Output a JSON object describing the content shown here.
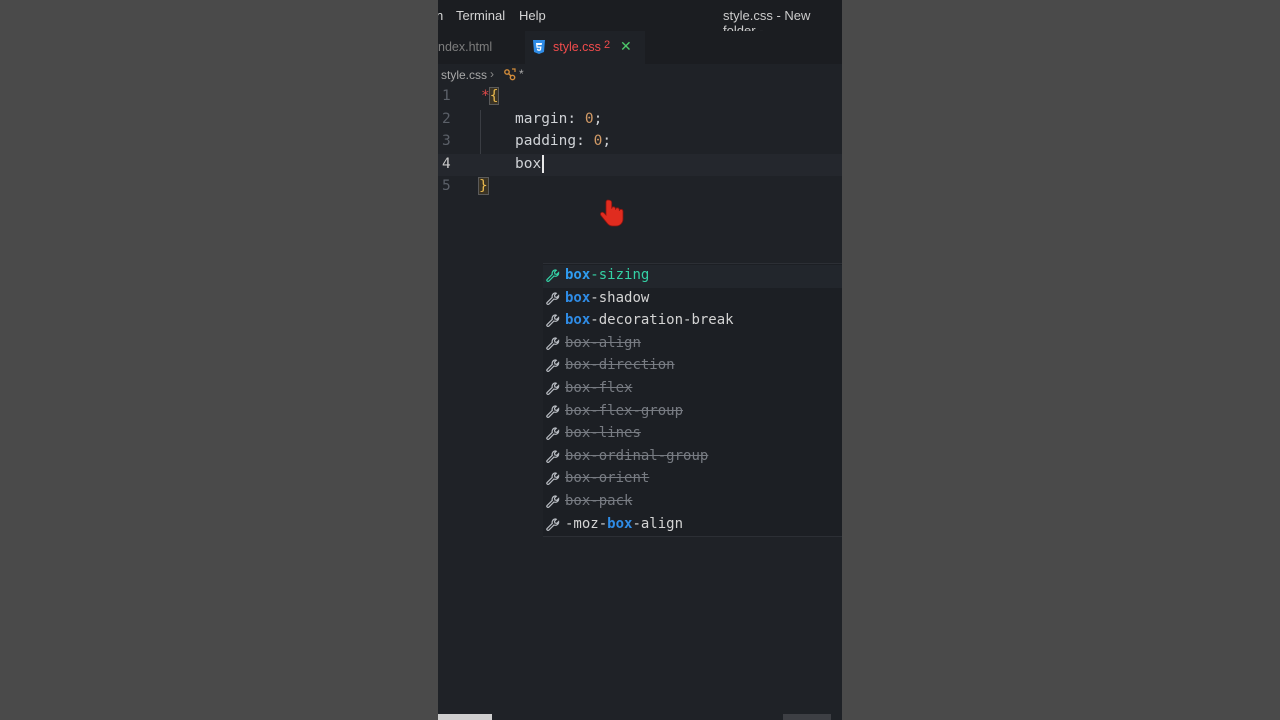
{
  "menubar": {
    "partial_item": "n",
    "terminal": "Terminal",
    "help": "Help",
    "title": "style.css - New folder -"
  },
  "tabs": {
    "inactive": "ndex.html",
    "active": {
      "name": "style.css",
      "problems": "2",
      "close": "✕"
    }
  },
  "breadcrumb": {
    "file": "style.css",
    "separator": "›",
    "symbol": "*"
  },
  "editor": {
    "line_numbers": [
      "1",
      "2",
      "3",
      "4",
      "5"
    ],
    "current_line": "4",
    "lines": [
      {
        "parts": [
          {
            "t": "*",
            "k": "star"
          },
          {
            "t": "{",
            "k": "brace"
          }
        ]
      },
      {
        "parts": [
          {
            "t": "margin: ",
            "k": "prop"
          },
          {
            "t": "0",
            "k": "num"
          },
          {
            "t": ";",
            "k": "prop"
          }
        ]
      },
      {
        "parts": [
          {
            "t": "padding: ",
            "k": "prop"
          },
          {
            "t": "0",
            "k": "num"
          },
          {
            "t": ";",
            "k": "prop"
          }
        ]
      },
      {
        "parts": [
          {
            "t": "box",
            "k": "prop"
          }
        ]
      },
      {
        "parts": [
          {
            "t": "}",
            "k": "brace"
          }
        ]
      }
    ]
  },
  "suggestions": [
    {
      "pre": "",
      "match": "box",
      "post": "-sizing",
      "state": "selected"
    },
    {
      "pre": "",
      "match": "box",
      "post": "-shadow",
      "state": "normal"
    },
    {
      "pre": "",
      "match": "box",
      "post": "-decoration-break",
      "state": "normal"
    },
    {
      "pre": "",
      "match": "box",
      "post": "-align",
      "state": "deprecated"
    },
    {
      "pre": "",
      "match": "box",
      "post": "-direction",
      "state": "deprecated"
    },
    {
      "pre": "",
      "match": "box",
      "post": "-flex",
      "state": "deprecated"
    },
    {
      "pre": "",
      "match": "box",
      "post": "-flex-group",
      "state": "deprecated"
    },
    {
      "pre": "",
      "match": "box",
      "post": "-lines",
      "state": "deprecated"
    },
    {
      "pre": "",
      "match": "box",
      "post": "-ordinal-group",
      "state": "deprecated"
    },
    {
      "pre": "",
      "match": "box",
      "post": "-orient",
      "state": "deprecated"
    },
    {
      "pre": "",
      "match": "box",
      "post": "-pack",
      "state": "deprecated"
    },
    {
      "pre": "-moz-",
      "match": "box",
      "post": "-align",
      "state": "normal"
    }
  ],
  "colors": {
    "match_highlight": "#2f8ce6",
    "selected_text": "#34d1a5",
    "error_tab": "#f14c4c",
    "close_icon": "#4ec96a",
    "brace": "#e8b84d",
    "number": "#d19a66"
  },
  "icons": {
    "suggestion_kind": "wrench-icon",
    "tab_file": "css3-icon",
    "breadcrumb_symbol": "symbol-icon",
    "pointer": "hand-pointer-icon"
  }
}
